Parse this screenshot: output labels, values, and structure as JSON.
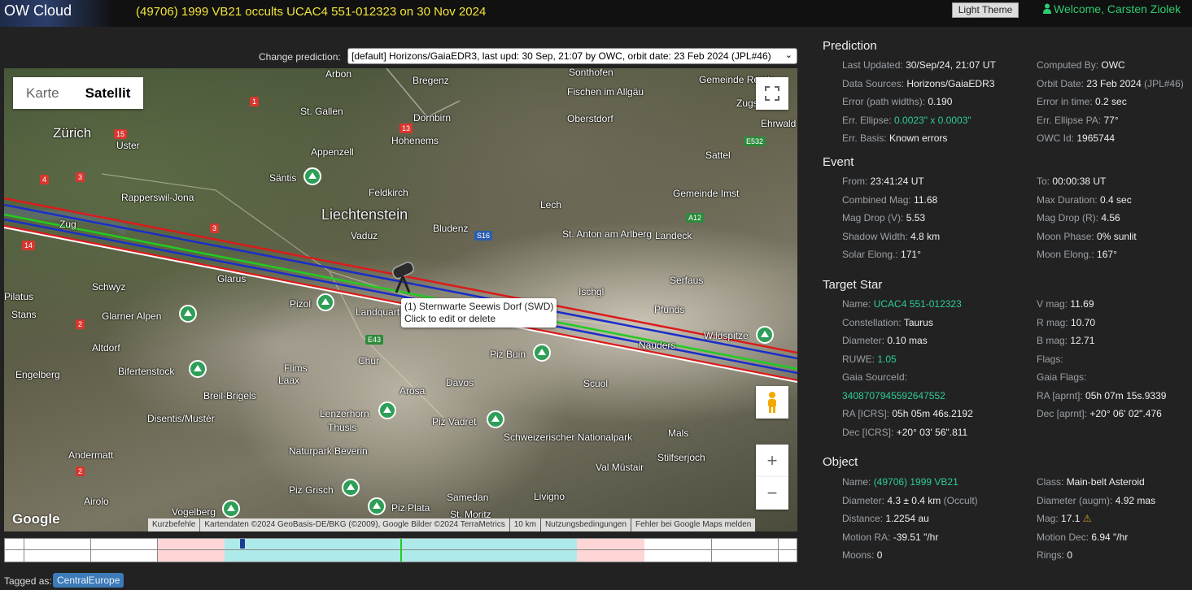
{
  "header": {
    "logo": "OW Cloud",
    "event_title": "(49706) 1999 VB21 occults UCAC4 551-012323 on 30 Nov 2024",
    "theme_button": "Light Theme",
    "welcome": "Welcome, Carsten Ziolek"
  },
  "prediction_select": {
    "label": "Change prediction:",
    "value": "[default] Horizons/GaiaEDR3, last upd: 30 Sep, 21:07 by OWC, orbit date: 23 Feb 2024 (JPL#46)"
  },
  "map": {
    "type_tabs": [
      "Karte",
      "Satellit"
    ],
    "active_tab": "Satellit",
    "places": [
      "Arbon",
      "Bregenz",
      "Sonthofen",
      "St. Gallen",
      "Dornbirn",
      "Zürich",
      "Hohenems",
      "Oberstdorf",
      "Uster",
      "Appenzell",
      "Säntis",
      "Rapperswil-Jona",
      "Feldkirch",
      "Lech",
      "Gemeinde Imst",
      "Liechtenstein",
      "Vaduz",
      "Bludenz",
      "St. Anton am Arlberg",
      "Landeck",
      "Zug",
      "Schwyz",
      "Glarus",
      "Ischgl",
      "Serfaus",
      "Pilatus",
      "Stans",
      "Glarner Alpen",
      "Pizol",
      "Landquart",
      "Pfunds",
      "Wildspitze",
      "Altdorf",
      "Chur",
      "Piz Buin",
      "Nauders",
      "Engelberg",
      "Bifertenstock",
      "Flims",
      "Laax",
      "Davos",
      "Scuol",
      "Breil-Brigels",
      "Arosa",
      "Disentis/Mustér",
      "Lenzerhorn",
      "Thusis",
      "Piz Vadret",
      "Schweizerischer Nationalpark",
      "Naturpark Beverin",
      "Mals",
      "Andermatt",
      "Val Müstair",
      "Stilfserjoch",
      "Piz Grisch",
      "Airolo",
      "Vogelberg",
      "Piz Plata",
      "Samedan",
      "St. Moritz",
      "Livigno",
      "Fischen im Allgäu",
      "Gemeinde Reutte",
      "Ehrwald",
      "Zugspitze",
      "Sattel"
    ],
    "station_popup": {
      "line1": "(1) Sternwarte Seewis Dorf (SWD)",
      "line2": "Click to edit or delete"
    },
    "google_logo": "Google",
    "attribution": [
      "Kurzbefehle",
      "Kartendaten ©2024 GeoBasis-DE/BKG (©2009), Google Bilder ©2024 TerraMetrics",
      "10 km",
      "Nutzungsbedingungen",
      "Fehler bei Google Maps melden"
    ],
    "path_colors": {
      "center": "#22cc22",
      "shadow_edge": "#1a2ec8",
      "error_limit": "#dd1a1a",
      "observer": "#ffffff"
    }
  },
  "tagged": {
    "label": "Tagged as:",
    "tag": "CentralEurope"
  },
  "prediction": {
    "title": "Prediction",
    "left": [
      {
        "k": "Last Updated:",
        "v": "30/Sep/24, 21:07 UT"
      },
      {
        "k": "Data Sources:",
        "v": "Horizons/GaiaEDR3"
      },
      {
        "k": "Error (path widths):",
        "v": "0.190"
      },
      {
        "k": "Err. Ellipse:",
        "v": "0.0023\" x 0.0003\"",
        "green": true
      },
      {
        "k": "Err. Basis:",
        "v": "Known errors"
      }
    ],
    "right": [
      {
        "k": "Computed By:",
        "v": "OWC"
      },
      {
        "k": "Orbit Date:",
        "v": "23 Feb 2024",
        "extra": "(JPL#46)"
      },
      {
        "k": "Error in time:",
        "v": "0.2 sec"
      },
      {
        "k": "Err. Ellipse PA:",
        "v": "77°"
      },
      {
        "k": "OWC Id:",
        "v": "1965744"
      }
    ]
  },
  "event": {
    "title": "Event",
    "left": [
      {
        "k": "From:",
        "v": "23:41:24 UT"
      },
      {
        "k": "Combined Mag:",
        "v": "11.68"
      },
      {
        "k": "Mag Drop (V):",
        "v": "5.53"
      },
      {
        "k": "Shadow Width:",
        "v": "4.8 km"
      },
      {
        "k": "Solar Elong.:",
        "v": "171°"
      }
    ],
    "right": [
      {
        "k": "To:",
        "v": "00:00:38 UT"
      },
      {
        "k": "Max Duration:",
        "v": "0.4 sec"
      },
      {
        "k": "Mag Drop (R):",
        "v": "4.56"
      },
      {
        "k": "Moon Phase:",
        "v": "0% sunlit"
      },
      {
        "k": "Moon Elong.:",
        "v": "167°"
      }
    ]
  },
  "target_star": {
    "title": "Target Star",
    "left": [
      {
        "k": "Name:",
        "v": "UCAC4 551-012323",
        "green": true
      },
      {
        "k": "Constellation:",
        "v": "Taurus"
      },
      {
        "k": "Diameter:",
        "v": "0.10 mas"
      },
      {
        "k": "RUWE:",
        "v": "1.05",
        "green": true
      },
      {
        "k": "Gaia SourceId:",
        "v": ""
      },
      {
        "k": "",
        "v": "3408707945592647552",
        "green": true
      },
      {
        "k": "RA [ICRS]:",
        "v": "05h 05m 46s.2192"
      },
      {
        "k": "Dec [ICRS]:",
        "v": "+20° 03' 56\".811"
      }
    ],
    "right": [
      {
        "k": "V mag:",
        "v": "11.69"
      },
      {
        "k": "R mag:",
        "v": "10.70"
      },
      {
        "k": "B mag:",
        "v": "12.71"
      },
      {
        "k": "Flags:",
        "v": ""
      },
      {
        "k": "Gaia Flags:",
        "v": ""
      },
      {
        "k": "RA [aprnt]:",
        "v": "05h 07m 15s.9339"
      },
      {
        "k": "Dec [aprnt]:",
        "v": "+20° 06' 02\".476"
      }
    ]
  },
  "object": {
    "title": "Object",
    "left": [
      {
        "k": "Name:",
        "v": "(49706) 1999 VB21",
        "green": true
      },
      {
        "k": "Diameter:",
        "v": "4.3 ± 0.4 km",
        "extra": "(Occult)"
      },
      {
        "k": "Distance:",
        "v": "1.2254 au"
      },
      {
        "k": "Motion RA:",
        "v": "-39.51 \"/hr"
      },
      {
        "k": "Moons:",
        "v": "0"
      }
    ],
    "right": [
      {
        "k": "Class:",
        "v": "Main-belt Asteroid"
      },
      {
        "k": "Diameter (augm):",
        "v": "4.92 mas"
      },
      {
        "k": "Mag:",
        "v": "17.1",
        "warn": true
      },
      {
        "k": "Motion Dec:",
        "v": "6.94 \"/hr"
      },
      {
        "k": "Rings:",
        "v": "0"
      }
    ]
  },
  "timeline": {
    "colors": {
      "error_zone": "#ffd6d6",
      "path_zone": "#aeeaea",
      "center": "#22cc22",
      "marker": "#1a3d8f"
    }
  }
}
